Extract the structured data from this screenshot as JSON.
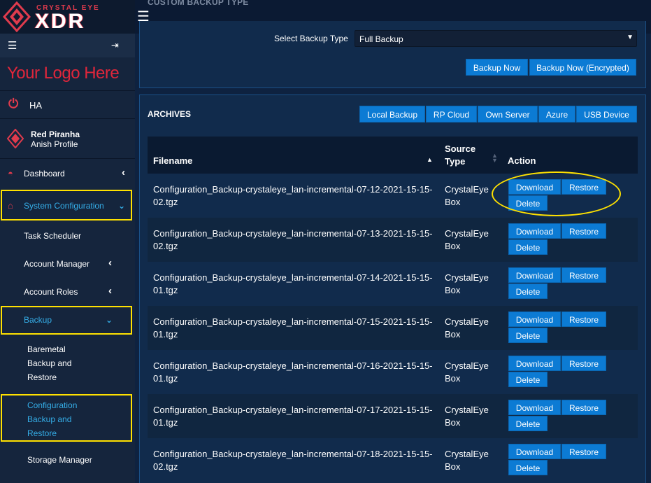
{
  "brand": {
    "line1": "CRYSTAL EYE",
    "line2": "XDR",
    "logo_placeholder": "Your Logo Here"
  },
  "sidebar": {
    "ha_label": "HA",
    "profile_name": "Red Piranha",
    "profile_sub": "Anish Profile",
    "items": [
      {
        "label": "Dashboard"
      },
      {
        "label": "System Configuration"
      },
      {
        "label": "Task Scheduler"
      },
      {
        "label": "Account Manager"
      },
      {
        "label": "Account Roles"
      },
      {
        "label": "Backup"
      },
      {
        "label": "Baremetal Backup and Restore"
      },
      {
        "label": "Configuration Backup and Restore"
      },
      {
        "label": "Storage Manager"
      }
    ]
  },
  "backup_type": {
    "section_title": "CUSTOM BACKUP TYPE",
    "label": "Select Backup Type",
    "selected": "Full Backup",
    "backup_now": "Backup Now",
    "backup_now_encrypted": "Backup Now (Encrypted)"
  },
  "archives": {
    "title": "ARCHIVES",
    "tabs": [
      "Local Backup",
      "RP Cloud",
      "Own Server",
      "Azure",
      "USB Device"
    ],
    "columns": {
      "filename": "Filename",
      "source_type": "Source Type",
      "action": "Action"
    },
    "download_label": "Download",
    "restore_label": "Restore",
    "delete_label": "Delete",
    "rows": [
      {
        "filename": "Configuration_Backup-crystaleye_lan-incremental-07-12-2021-15-15-02.tgz",
        "source": "CrystalEye Box"
      },
      {
        "filename": "Configuration_Backup-crystaleye_lan-incremental-07-13-2021-15-15-02.tgz",
        "source": "CrystalEye Box"
      },
      {
        "filename": "Configuration_Backup-crystaleye_lan-incremental-07-14-2021-15-15-01.tgz",
        "source": "CrystalEye Box"
      },
      {
        "filename": "Configuration_Backup-crystaleye_lan-incremental-07-15-2021-15-15-01.tgz",
        "source": "CrystalEye Box"
      },
      {
        "filename": "Configuration_Backup-crystaleye_lan-incremental-07-16-2021-15-15-01.tgz",
        "source": "CrystalEye Box"
      },
      {
        "filename": "Configuration_Backup-crystaleye_lan-incremental-07-17-2021-15-15-01.tgz",
        "source": "CrystalEye Box"
      },
      {
        "filename": "Configuration_Backup-crystaleye_lan-incremental-07-18-2021-15-15-02.tgz",
        "source": "CrystalEye Box"
      }
    ]
  },
  "colors": {
    "accent": "#0c7bd4",
    "brand_red": "#e03b4d",
    "highlight": "#ffe100",
    "active_text": "#35aee8"
  }
}
